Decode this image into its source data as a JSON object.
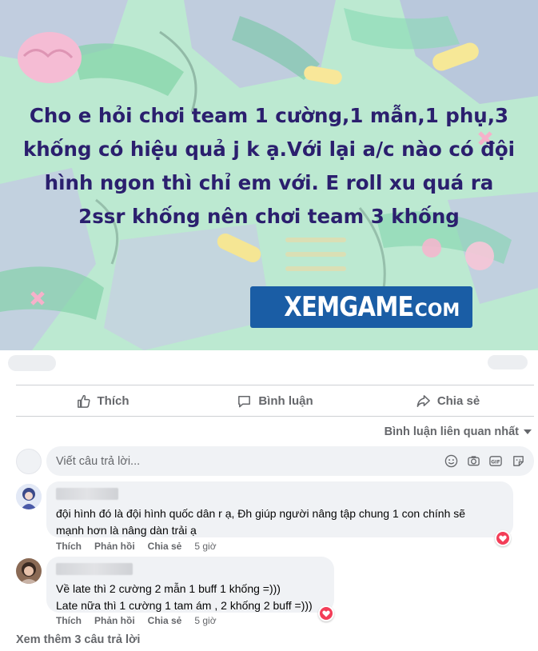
{
  "post": {
    "text": "Cho e hỏi chơi team 1 cường,1 mẫn,1 phụ,3 khống có hiệu quả j k ạ.Với lại a/c nào có đội hình ngon thì chỉ em với. E roll xu quá ra 2ssr khống nên chơi team 3 khống",
    "watermark": "XEMGAME",
    "watermark_suffix": ".COM",
    "background_color": "#a9e3c4",
    "text_color": "#2b1f6e"
  },
  "actions": {
    "like": "Thích",
    "comment": "Bình luận",
    "share": "Chia sẻ"
  },
  "sort": {
    "label": "Bình luận liên quan nhất",
    "icon": "caret-down-icon"
  },
  "composer": {
    "placeholder": "Viết câu trả lời...",
    "tools": [
      "emoji-icon",
      "camera-icon",
      "gif-icon",
      "sticker-icon"
    ]
  },
  "comments": [
    {
      "text": "đội hình đó là đội hình quốc dân r ạ, Đh giúp người nâng tập chung 1 con chính sẽ\nmạnh hơn là nâng dàn trải ạ",
      "like": "Thích",
      "reply": "Phản hồi",
      "share": "Chia sẻ",
      "time": "5 giờ",
      "reaction": "love"
    },
    {
      "text": "Về late thì 2 cường 2 mẫn 1 buff 1 khống =)))\nLate nữa thì 1 cường 1 tam ám , 2 khống 2 buff =)))",
      "like": "Thích",
      "reply": "Phản hồi",
      "share": "Chia sẻ",
      "time": "5 giờ",
      "reaction": "love"
    }
  ],
  "more_replies": "Xem thêm 3 câu trả lời",
  "colors": {
    "secondary_text": "#65676b",
    "bubble": "#f0f2f5",
    "love": "#f33e58",
    "watermark_bg": "#1a5da5"
  }
}
